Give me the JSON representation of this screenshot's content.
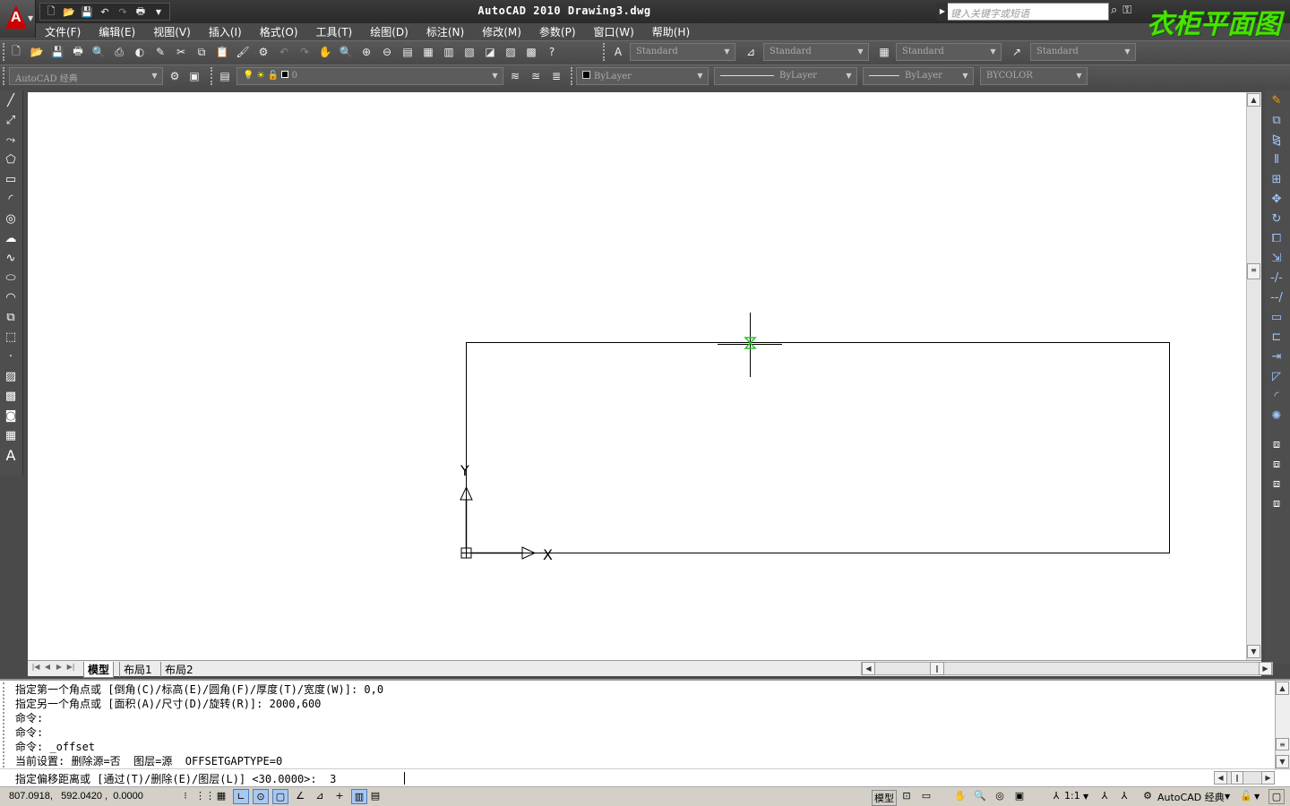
{
  "title": {
    "app": "AutoCAD 2010",
    "document": "Drawing3.dwg",
    "search_placeholder": "键入关键字或短语",
    "watermark": "衣柜平面图"
  },
  "menus": [
    "文件(F)",
    "编辑(E)",
    "视图(V)",
    "插入(I)",
    "格式(O)",
    "工具(T)",
    "绘图(D)",
    "标注(N)",
    "修改(M)",
    "参数(P)",
    "窗口(W)",
    "帮助(H)"
  ],
  "styles": {
    "text_style": "Standard",
    "dim_style": "Standard",
    "table_style": "Standard",
    "mleader_style": "Standard"
  },
  "workspace": "AutoCAD 经典",
  "layers": {
    "current": "0",
    "color": "ByLayer",
    "linetype": "ByLayer",
    "lineweight": "ByLayer",
    "plotstyle": "BYCOLOR"
  },
  "layout_tabs": [
    "模型",
    "布局1",
    "布局2"
  ],
  "command_history": [
    "指定第一个角点或 [倒角(C)/标高(E)/圆角(F)/厚度(T)/宽度(W)]: 0,0",
    "指定另一个角点或 [面积(A)/尺寸(D)/旋转(R)]: 2000,600",
    "命令:",
    "命令:",
    "命令: _offset",
    "当前设置: 删除源=否  图层=源  OFFSETGAPTYPE=0"
  ],
  "command_prompt": "指定偏移距离或 [通过(T)/删除(E)/图层(L)] <30.0000>:  3",
  "status": {
    "coordinates": "807.0918,   592.0420 ,  0.0000",
    "model_label": "模型",
    "annotation_scale": "1:1",
    "workspace_label": "AutoCAD 经典"
  },
  "icons": {
    "quick_access": [
      "new-icon",
      "open-icon",
      "save-icon",
      "undo-icon",
      "redo-icon",
      "plot-icon"
    ],
    "draw": [
      "line-icon",
      "construction-line-icon",
      "polyline-icon",
      "polygon-icon",
      "rectangle-icon",
      "arc-icon",
      "circle-icon",
      "revcloud-icon",
      "spline-icon",
      "ellipse-icon",
      "ellipse-arc-icon",
      "insert-block-icon",
      "make-block-icon",
      "point-icon",
      "hatch-icon",
      "gradient-icon",
      "region-icon",
      "table-icon",
      "mtext-icon"
    ],
    "modify": [
      "erase-icon",
      "copy-icon",
      "mirror-icon",
      "offset-icon",
      "array-icon",
      "move-icon",
      "rotate-icon",
      "scale-icon",
      "stretch-icon",
      "trim-icon",
      "extend-icon",
      "break-at-point-icon",
      "break-icon",
      "join-icon",
      "chamfer-icon",
      "fillet-icon",
      "explode-icon"
    ]
  }
}
